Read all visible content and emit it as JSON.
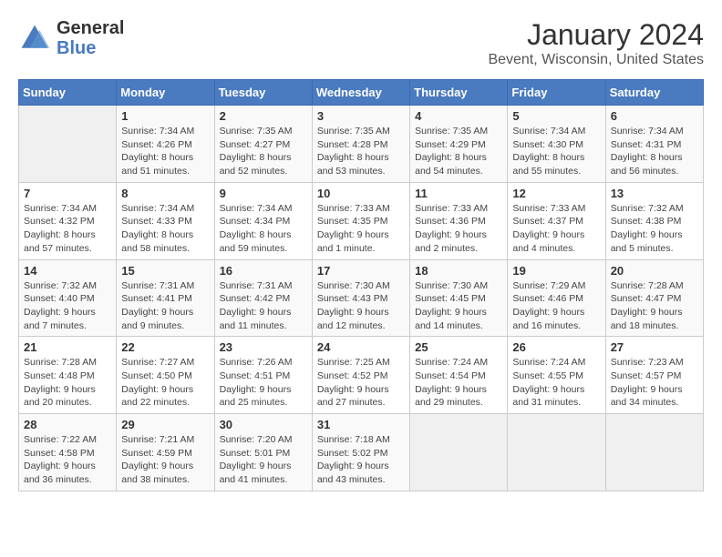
{
  "logo": {
    "general": "General",
    "blue": "Blue"
  },
  "title": "January 2024",
  "subtitle": "Bevent, Wisconsin, United States",
  "days_of_week": [
    "Sunday",
    "Monday",
    "Tuesday",
    "Wednesday",
    "Thursday",
    "Friday",
    "Saturday"
  ],
  "weeks": [
    [
      {
        "day": "",
        "sunrise": "",
        "sunset": "",
        "daylight": ""
      },
      {
        "day": "1",
        "sunrise": "7:34 AM",
        "sunset": "4:26 PM",
        "daylight": "8 hours and 51 minutes."
      },
      {
        "day": "2",
        "sunrise": "7:35 AM",
        "sunset": "4:27 PM",
        "daylight": "8 hours and 52 minutes."
      },
      {
        "day": "3",
        "sunrise": "7:35 AM",
        "sunset": "4:28 PM",
        "daylight": "8 hours and 53 minutes."
      },
      {
        "day": "4",
        "sunrise": "7:35 AM",
        "sunset": "4:29 PM",
        "daylight": "8 hours and 54 minutes."
      },
      {
        "day": "5",
        "sunrise": "7:34 AM",
        "sunset": "4:30 PM",
        "daylight": "8 hours and 55 minutes."
      },
      {
        "day": "6",
        "sunrise": "7:34 AM",
        "sunset": "4:31 PM",
        "daylight": "8 hours and 56 minutes."
      }
    ],
    [
      {
        "day": "7",
        "sunrise": "7:34 AM",
        "sunset": "4:32 PM",
        "daylight": "8 hours and 57 minutes."
      },
      {
        "day": "8",
        "sunrise": "7:34 AM",
        "sunset": "4:33 PM",
        "daylight": "8 hours and 58 minutes."
      },
      {
        "day": "9",
        "sunrise": "7:34 AM",
        "sunset": "4:34 PM",
        "daylight": "8 hours and 59 minutes."
      },
      {
        "day": "10",
        "sunrise": "7:33 AM",
        "sunset": "4:35 PM",
        "daylight": "9 hours and 1 minute."
      },
      {
        "day": "11",
        "sunrise": "7:33 AM",
        "sunset": "4:36 PM",
        "daylight": "9 hours and 2 minutes."
      },
      {
        "day": "12",
        "sunrise": "7:33 AM",
        "sunset": "4:37 PM",
        "daylight": "9 hours and 4 minutes."
      },
      {
        "day": "13",
        "sunrise": "7:32 AM",
        "sunset": "4:38 PM",
        "daylight": "9 hours and 5 minutes."
      }
    ],
    [
      {
        "day": "14",
        "sunrise": "7:32 AM",
        "sunset": "4:40 PM",
        "daylight": "9 hours and 7 minutes."
      },
      {
        "day": "15",
        "sunrise": "7:31 AM",
        "sunset": "4:41 PM",
        "daylight": "9 hours and 9 minutes."
      },
      {
        "day": "16",
        "sunrise": "7:31 AM",
        "sunset": "4:42 PM",
        "daylight": "9 hours and 11 minutes."
      },
      {
        "day": "17",
        "sunrise": "7:30 AM",
        "sunset": "4:43 PM",
        "daylight": "9 hours and 12 minutes."
      },
      {
        "day": "18",
        "sunrise": "7:30 AM",
        "sunset": "4:45 PM",
        "daylight": "9 hours and 14 minutes."
      },
      {
        "day": "19",
        "sunrise": "7:29 AM",
        "sunset": "4:46 PM",
        "daylight": "9 hours and 16 minutes."
      },
      {
        "day": "20",
        "sunrise": "7:28 AM",
        "sunset": "4:47 PM",
        "daylight": "9 hours and 18 minutes."
      }
    ],
    [
      {
        "day": "21",
        "sunrise": "7:28 AM",
        "sunset": "4:48 PM",
        "daylight": "9 hours and 20 minutes."
      },
      {
        "day": "22",
        "sunrise": "7:27 AM",
        "sunset": "4:50 PM",
        "daylight": "9 hours and 22 minutes."
      },
      {
        "day": "23",
        "sunrise": "7:26 AM",
        "sunset": "4:51 PM",
        "daylight": "9 hours and 25 minutes."
      },
      {
        "day": "24",
        "sunrise": "7:25 AM",
        "sunset": "4:52 PM",
        "daylight": "9 hours and 27 minutes."
      },
      {
        "day": "25",
        "sunrise": "7:24 AM",
        "sunset": "4:54 PM",
        "daylight": "9 hours and 29 minutes."
      },
      {
        "day": "26",
        "sunrise": "7:24 AM",
        "sunset": "4:55 PM",
        "daylight": "9 hours and 31 minutes."
      },
      {
        "day": "27",
        "sunrise": "7:23 AM",
        "sunset": "4:57 PM",
        "daylight": "9 hours and 34 minutes."
      }
    ],
    [
      {
        "day": "28",
        "sunrise": "7:22 AM",
        "sunset": "4:58 PM",
        "daylight": "9 hours and 36 minutes."
      },
      {
        "day": "29",
        "sunrise": "7:21 AM",
        "sunset": "4:59 PM",
        "daylight": "9 hours and 38 minutes."
      },
      {
        "day": "30",
        "sunrise": "7:20 AM",
        "sunset": "5:01 PM",
        "daylight": "9 hours and 41 minutes."
      },
      {
        "day": "31",
        "sunrise": "7:18 AM",
        "sunset": "5:02 PM",
        "daylight": "9 hours and 43 minutes."
      },
      {
        "day": "",
        "sunrise": "",
        "sunset": "",
        "daylight": ""
      },
      {
        "day": "",
        "sunrise": "",
        "sunset": "",
        "daylight": ""
      },
      {
        "day": "",
        "sunrise": "",
        "sunset": "",
        "daylight": ""
      }
    ]
  ],
  "labels": {
    "sunrise": "Sunrise:",
    "sunset": "Sunset:",
    "daylight": "Daylight:"
  }
}
